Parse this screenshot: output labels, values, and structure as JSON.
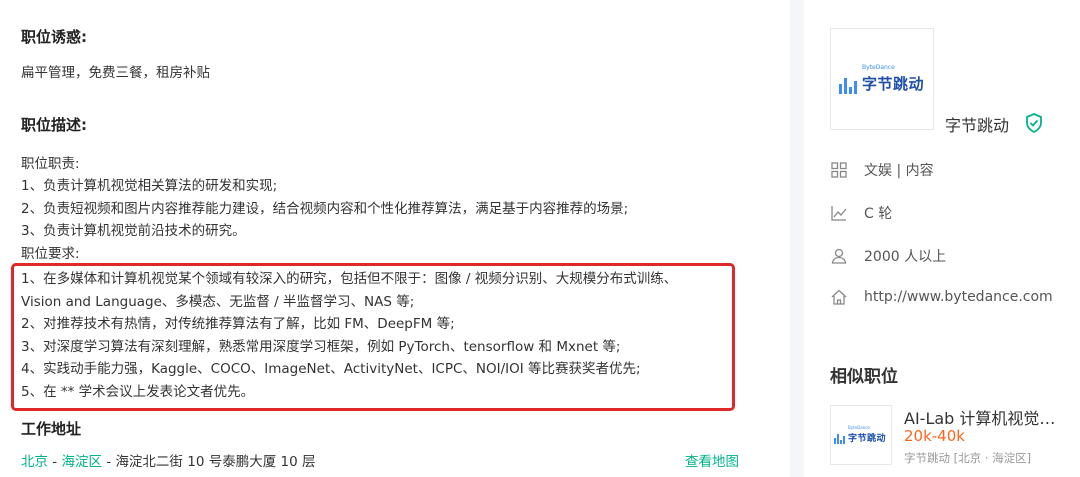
{
  "job": {
    "perks_heading": "职位诱惑:",
    "perks": "扁平管理，免费三餐，租房补贴",
    "desc_heading": "职位描述:",
    "responsibilities_label": "职位职责:",
    "responsibilities": [
      "1、负责计算机视觉相关算法的研发和实现;",
      "2、负责短视频和图片内容推荐能力建设，结合视频内容和个性化推荐算法，满足基于内容推荐的场景;",
      "3、负责计算机视觉前沿技术的研究。"
    ],
    "requirements_label": "职位要求:",
    "requirements": [
      "1、在多媒体和计算机视觉某个领域有较深入的研究，包括但不限于：图像 / 视频分识别、大规模分布式训练、",
      "Vision and Language、多模态、无监督 / 半监督学习、NAS 等;",
      "2、对推荐技术有热情，对传统推荐算法有了解，比如 FM、DeepFM 等;",
      "3、对深度学习算法有深刻理解，熟悉常用深度学习框架，例如 PyTorch、tensorflow 和 Mxnet 等;",
      "4、实践动手能力强，Kaggle、COCO、ImageNet、ActivityNet、ICPC、NOI/IOI 等比赛获奖者优先;",
      "5、在 ** 学术会议上发表论文者优先。"
    ],
    "address_heading": "工作地址",
    "address": {
      "city": "北京",
      "sep1": " - ",
      "district": "海淀区",
      "sep2": " - ",
      "street": "海淀北二街 10 号泰鹏大厦 10 层"
    },
    "map_link": "查看地图"
  },
  "company": {
    "logo_en": "ByteDance",
    "logo_cn": "字节跳动",
    "name": "字节跳动",
    "verified_icon": "shield-check-icon",
    "industry": "文娱 | 内容",
    "stage": "C 轮",
    "size": "2000 人以上",
    "website": "http://www.bytedance.com",
    "brand_color": "#3c8cff"
  },
  "similar": {
    "heading": "相似职位",
    "items": [
      {
        "title": "AI-Lab 计算机视觉…",
        "salary": "20k-40k",
        "meta": "字节跳动 [北京 · 海淀区]"
      }
    ]
  },
  "colors": {
    "accent_green": "#00b38a",
    "salary_orange": "#fd661f",
    "highlight_red": "#e02828"
  }
}
